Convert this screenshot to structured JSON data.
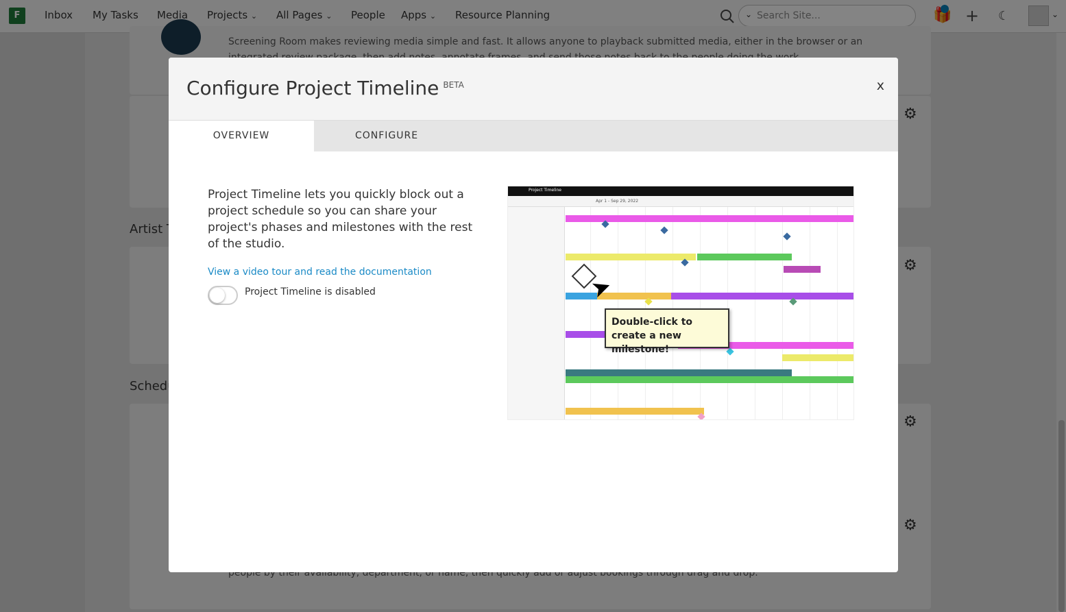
{
  "nav": {
    "logo": "F",
    "items": [
      "Inbox",
      "My Tasks",
      "Media",
      "Projects",
      "All Pages",
      "People",
      "Apps",
      "Resource Planning"
    ],
    "search_placeholder": "Search Site..."
  },
  "background": {
    "screening_text": "Screening Room makes reviewing media simple and fast. It allows anyone to playback submitted media, either in the browser or an",
    "screening_text2": "integrated review package, then add notes, annotate frames, and send those notes back to the people doing the work.",
    "section_artist": "Artist T",
    "section_schedule": "Schedu",
    "resource_text": "people by their availability, department, or name, then quickly add or adjust bookings through drag and drop."
  },
  "modal": {
    "title": "Configure Project Timeline",
    "badge": "BETA",
    "close": "x",
    "tabs": [
      {
        "label": "OVERVIEW",
        "active": true
      },
      {
        "label": "CONFIGURE",
        "active": false
      }
    ],
    "description": "Project Timeline lets you quickly block out a project schedule so you can share your project's phases and milestones with the rest of the studio.",
    "link": "View a video tour and read the documentation",
    "toggle_label": "Project Timeline is disabled",
    "toggle_on": false,
    "preview": {
      "app_title": "Project Timeline",
      "date_range": "Apr 1 - Sep 29, 2022",
      "callout": "Double-click to create a new milestone!"
    }
  },
  "colors": {
    "accent": "#1a8ac6",
    "notification": "#0a7fb5",
    "logo": "#1f7a3a"
  }
}
